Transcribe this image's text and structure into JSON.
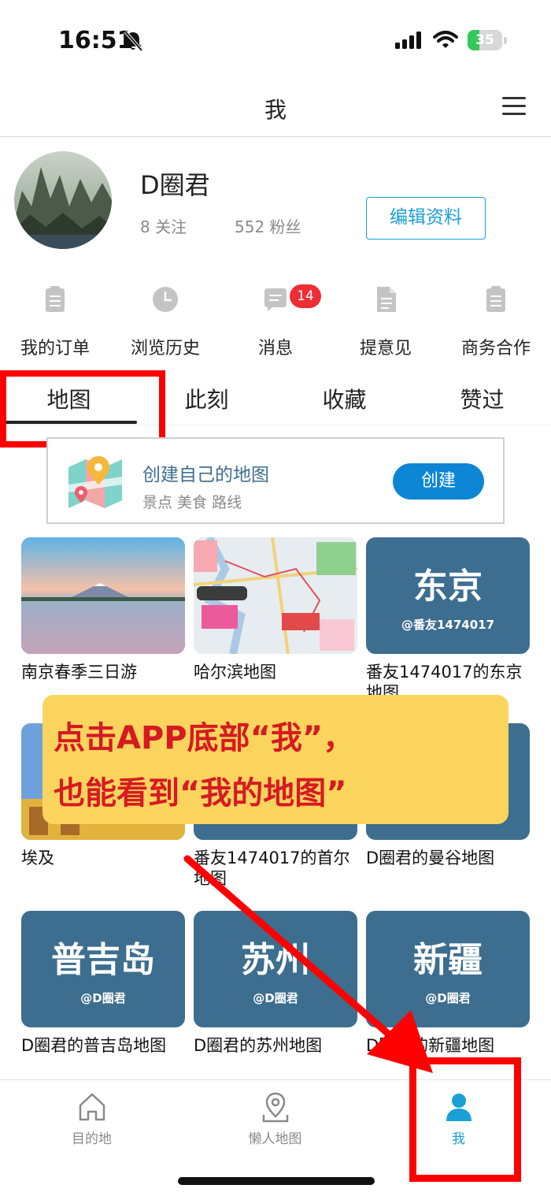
{
  "status_bar": {
    "time": "16:51",
    "battery": "35",
    "battery_level": 0.35
  },
  "header": {
    "title": "我"
  },
  "profile": {
    "username": "D圈君",
    "following": "8 关注",
    "followers": "552 粉丝",
    "edit_label": "编辑资料"
  },
  "quick_menu": [
    {
      "label": "我的订单",
      "icon": "clipboard-icon"
    },
    {
      "label": "浏览历史",
      "icon": "clock-icon"
    },
    {
      "label": "消息",
      "icon": "chat-icon"
    },
    {
      "label": "提意见",
      "icon": "document-icon"
    },
    {
      "label": "商务合作",
      "icon": "clipboard-icon"
    }
  ],
  "message_badge": "14",
  "tabs": [
    {
      "label": "地图",
      "active": true
    },
    {
      "label": "此刻"
    },
    {
      "label": "收藏"
    },
    {
      "label": "赞过"
    }
  ],
  "create_card": {
    "title": "创建自己的地图",
    "subtitle": "景点 美食 路线",
    "button": "创建"
  },
  "maps": [
    {
      "name": "南京春季三日游",
      "thumb": "photo-lake"
    },
    {
      "name": "哈尔滨地图",
      "thumb": "photo-map"
    },
    {
      "name": "番友1474017的东京地图",
      "city": "东京",
      "owner": "@番友1474017"
    },
    {
      "name": "埃及",
      "thumb": "photo-building"
    },
    {
      "name": "番友1474017的首尔地图"
    },
    {
      "name": "D圈君的曼谷地图"
    },
    {
      "name": "D圈君的普吉岛地图",
      "city": "普吉岛",
      "owner": "@D圈君"
    },
    {
      "name": "D圈君的苏州地图",
      "city": "苏州",
      "owner": "@D圈君"
    },
    {
      "name": "D圈君的新疆地图",
      "city": "新疆",
      "owner": "@D圈君"
    }
  ],
  "annotation": {
    "line1": "点击APP底部“我”，",
    "line2": "也能看到“我的地图”"
  },
  "tab_bar": [
    {
      "label": "目的地",
      "icon": "home-icon"
    },
    {
      "label": "懒人地图",
      "icon": "map-pin-icon"
    },
    {
      "label": "我",
      "icon": "person-icon",
      "active": true
    }
  ],
  "colors": {
    "accent": "#1a9fd6",
    "map_tile": "#3d6e8f",
    "badge": "#ef2d35",
    "annotation_bg": "#fbd45e",
    "annotation_text": "#d61a22",
    "highlight": "#ff0000"
  }
}
